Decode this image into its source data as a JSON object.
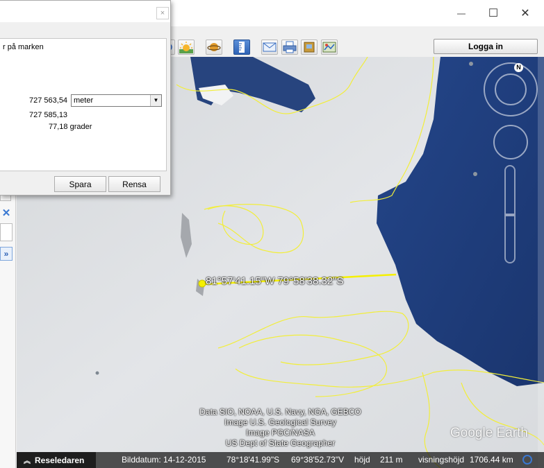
{
  "window": {
    "controls": {
      "minimize": "—",
      "maximize": "☐",
      "close": "✕"
    }
  },
  "toolbar": {
    "login_label": "Logga in",
    "buttons": [
      "globe-partial-icon",
      "sun-icon",
      "planet-icon",
      "ruler-icon",
      "email-icon",
      "print-icon",
      "save-image-icon",
      "view-in-maps-icon"
    ],
    "active_button": "ruler-icon"
  },
  "dialog": {
    "close_glyph": "×",
    "description": "r på marken",
    "length_value": "727 563,54",
    "unit": "meter",
    "ground_length_value": "727 585,13",
    "heading_value": "77,18 grader",
    "save_label": "Spara",
    "clear_label": "Rensa"
  },
  "sidebar": {
    "close_glyph": "✕",
    "expand_glyph": "»"
  },
  "map": {
    "path_label": "81°57'41.15\"W 79°58'38.32\"S",
    "compass_north": "N",
    "attribution": [
      "Data SIO, NOAA, U.S. Navy, NGA, GEBCO",
      "Image U.S. Geological Survey",
      "Image PGC/NASA",
      "US Dept of State Geographer"
    ],
    "logo": "Google Earth",
    "colors": {
      "ocean": "#1f3f7e",
      "ice": "#dcdfe2",
      "border_line": "#f2ee3a",
      "ruler_line": "#f5f000"
    }
  },
  "status": {
    "tour_guide": "Reseledaren",
    "imagery_date": "Bilddatum: 14-12-2015",
    "latitude": "78°18'41.99\"S",
    "longitude": "69°38'52.73\"V",
    "elevation_label": "höjd",
    "elevation_value": "211 m",
    "eye_alt_label": "visningshöjd",
    "eye_alt_value": "1706.44 km"
  }
}
